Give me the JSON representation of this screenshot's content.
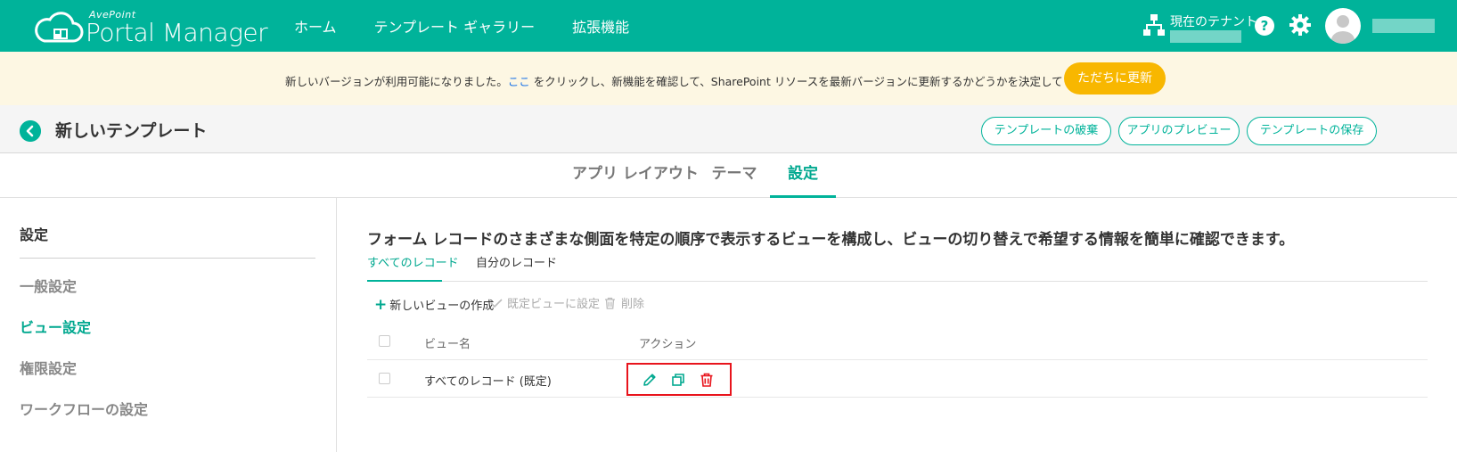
{
  "header": {
    "brand_small": "AvePoint",
    "brand_main": "Portal Manager",
    "nav": [
      "ホーム",
      "テンプレート ギャラリー",
      "拡張機能"
    ],
    "tenant_label": "現在のテナント:",
    "help_label": "?",
    "colors": {
      "primary": "#00b39a"
    }
  },
  "banner": {
    "text_before": "新しいバージョンが利用可能になりました。",
    "link": "ここ",
    "text_after": " をクリックし、新機能を確認して、SharePoint リソースを最新バージョンに更新するかどうかを決定してください。",
    "update_button": "ただちに更新",
    "colors": {
      "background": "#fdf7e3",
      "button": "#f8b700"
    }
  },
  "titlebar": {
    "title": "新しいテンプレート",
    "buttons": [
      "テンプレートの破棄",
      "アプリのプレビュー",
      "テンプレートの保存"
    ]
  },
  "main_tabs": {
    "items": [
      "アプリ レイアウト",
      "テーマ",
      "設定"
    ],
    "active": "設定"
  },
  "sidebar": {
    "heading": "設定",
    "items": [
      "一般設定",
      "ビュー設定",
      "権限設定",
      "ワークフローの設定"
    ],
    "active": "ビュー設定"
  },
  "content": {
    "description": "フォーム レコードのさまざまな側面を特定の順序で表示するビューを構成し、ビューの切り替えで希望する情報を簡単に確認できます。",
    "sub_tabs": [
      "すべてのレコード",
      "自分のレコード"
    ],
    "active_sub_tab": "すべてのレコード",
    "toolbar": {
      "create": "新しいビューの作成",
      "set_default": "既定ビューに設定",
      "delete": "削除"
    },
    "table": {
      "columns": [
        "ビュー名",
        "アクション"
      ],
      "rows": [
        {
          "name": "すべてのレコード (既定)",
          "actions": [
            "edit-icon",
            "copy-icon",
            "trash-icon"
          ]
        }
      ]
    },
    "colors": {
      "highlight_box": "#e8141c",
      "delete_icon": "#e8141c"
    }
  }
}
